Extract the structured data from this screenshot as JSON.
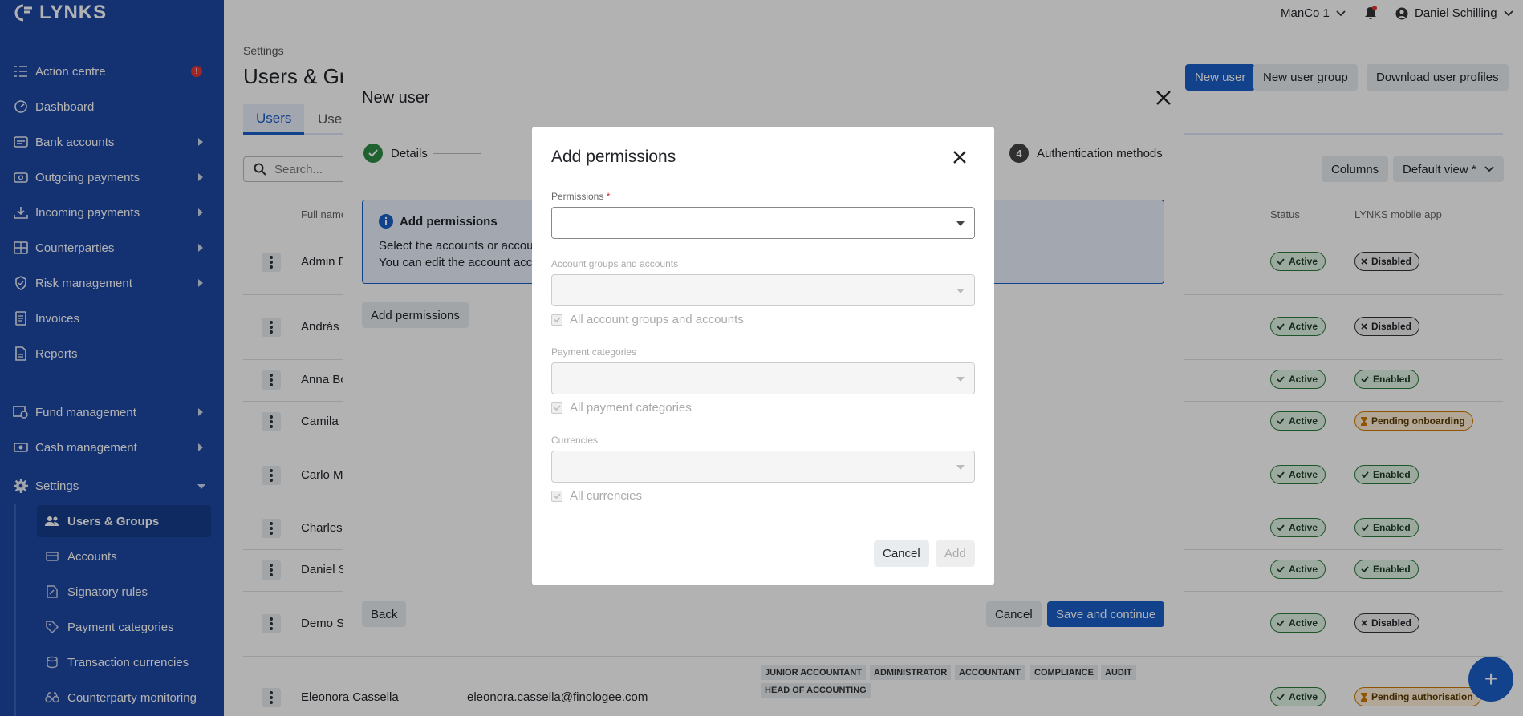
{
  "app": {
    "logo": "LYNKS"
  },
  "sidebar": {
    "items": [
      {
        "label": "Action centre",
        "icon": "action-centre-icon",
        "badge": "!"
      },
      {
        "label": "Dashboard",
        "icon": "dashboard-icon"
      },
      {
        "label": "Bank accounts",
        "icon": "bank-icon"
      },
      {
        "label": "Outgoing payments",
        "icon": "outgoing-payments-icon"
      },
      {
        "label": "Incoming payments",
        "icon": "incoming-payments-icon"
      },
      {
        "label": "Counterparties",
        "icon": "counterparties-icon"
      },
      {
        "label": "Risk management",
        "icon": "shield-icon"
      },
      {
        "label": "Invoices",
        "icon": "invoice-icon"
      },
      {
        "label": "Reports",
        "icon": "report-icon"
      },
      {
        "label": "Fund management",
        "icon": "fund-icon"
      },
      {
        "label": "Cash management",
        "icon": "cash-icon"
      },
      {
        "label": "Settings",
        "icon": "gear-icon"
      }
    ],
    "settings_sub": [
      {
        "label": "Users & Groups"
      },
      {
        "label": "Accounts"
      },
      {
        "label": "Signatory rules"
      },
      {
        "label": "Payment categories"
      },
      {
        "label": "Transaction currencies"
      },
      {
        "label": "Counterparty monitoring"
      }
    ]
  },
  "topbar": {
    "company": "ManCo 1",
    "user": "Daniel Schilling"
  },
  "page": {
    "breadcrumb": "Settings",
    "title": "Users & Groups",
    "buttons": {
      "new_user": "New user",
      "new_user_group": "New user group",
      "download": "Download user profiles"
    },
    "tabs": [
      "Users",
      "User groups"
    ],
    "search_placeholder": "Search...",
    "columns_btn": "Columns",
    "view_btn": "Default view *",
    "headers": {
      "full_name": "Full name",
      "status": "Status",
      "mobile": "LYNKS mobile app"
    }
  },
  "table": {
    "rows": [
      {
        "name": "Admin D",
        "email": "",
        "status": "Active",
        "mobile": "Disabled"
      },
      {
        "name": "András",
        "email": "",
        "status": "Active",
        "mobile": "Disabled"
      },
      {
        "name": "Anna Bo",
        "email": "",
        "status": "Active",
        "mobile": "Enabled"
      },
      {
        "name": "Camila",
        "email": "",
        "status": "Active",
        "mobile": "Pending onboarding"
      },
      {
        "name": "Carlo M",
        "email": "",
        "status": "Active",
        "mobile": "Enabled"
      },
      {
        "name": "Charles",
        "email": "",
        "status": "Active",
        "mobile": "Enabled"
      },
      {
        "name": "Daniel S",
        "email": "",
        "status": "Active",
        "mobile": "Enabled"
      },
      {
        "name": "Demo S",
        "email": "",
        "status": "Active",
        "mobile": "Disabled"
      },
      {
        "name": "Eleonora Cassella",
        "email": "eleonora.cassella@finologee.com",
        "status": "Active",
        "mobile": "Pending authorisation"
      }
    ],
    "last_row_roles": [
      "JUNIOR ACCOUNTANT",
      "ADMINISTRATOR",
      "ACCOUNTANT",
      "COMPLIANCE",
      "AUDIT",
      "HEAD OF ACCOUNTING"
    ]
  },
  "fab": {
    "label": "+"
  },
  "new_user_modal": {
    "title": "New user",
    "steps": {
      "first": "Details",
      "last_num": "4",
      "last": "Authentication methods"
    },
    "info_title": "Add permissions",
    "info_line1": "Select the accounts or accou",
    "info_line2": "You can edit the account acc",
    "add_permissions_btn": "Add permissions",
    "back": "Back",
    "cancel": "Cancel",
    "save": "Save and continue"
  },
  "permissions_modal": {
    "title": "Add permissions",
    "permissions_label": "Permissions",
    "required_mark": "*",
    "account_groups_label": "Account groups and accounts",
    "all_accounts": "All account groups and accounts",
    "payment_categories_label": "Payment categories",
    "all_payment_categories": "All payment categories",
    "currencies_label": "Currencies",
    "all_currencies": "All currencies",
    "cancel": "Cancel",
    "add": "Add"
  }
}
